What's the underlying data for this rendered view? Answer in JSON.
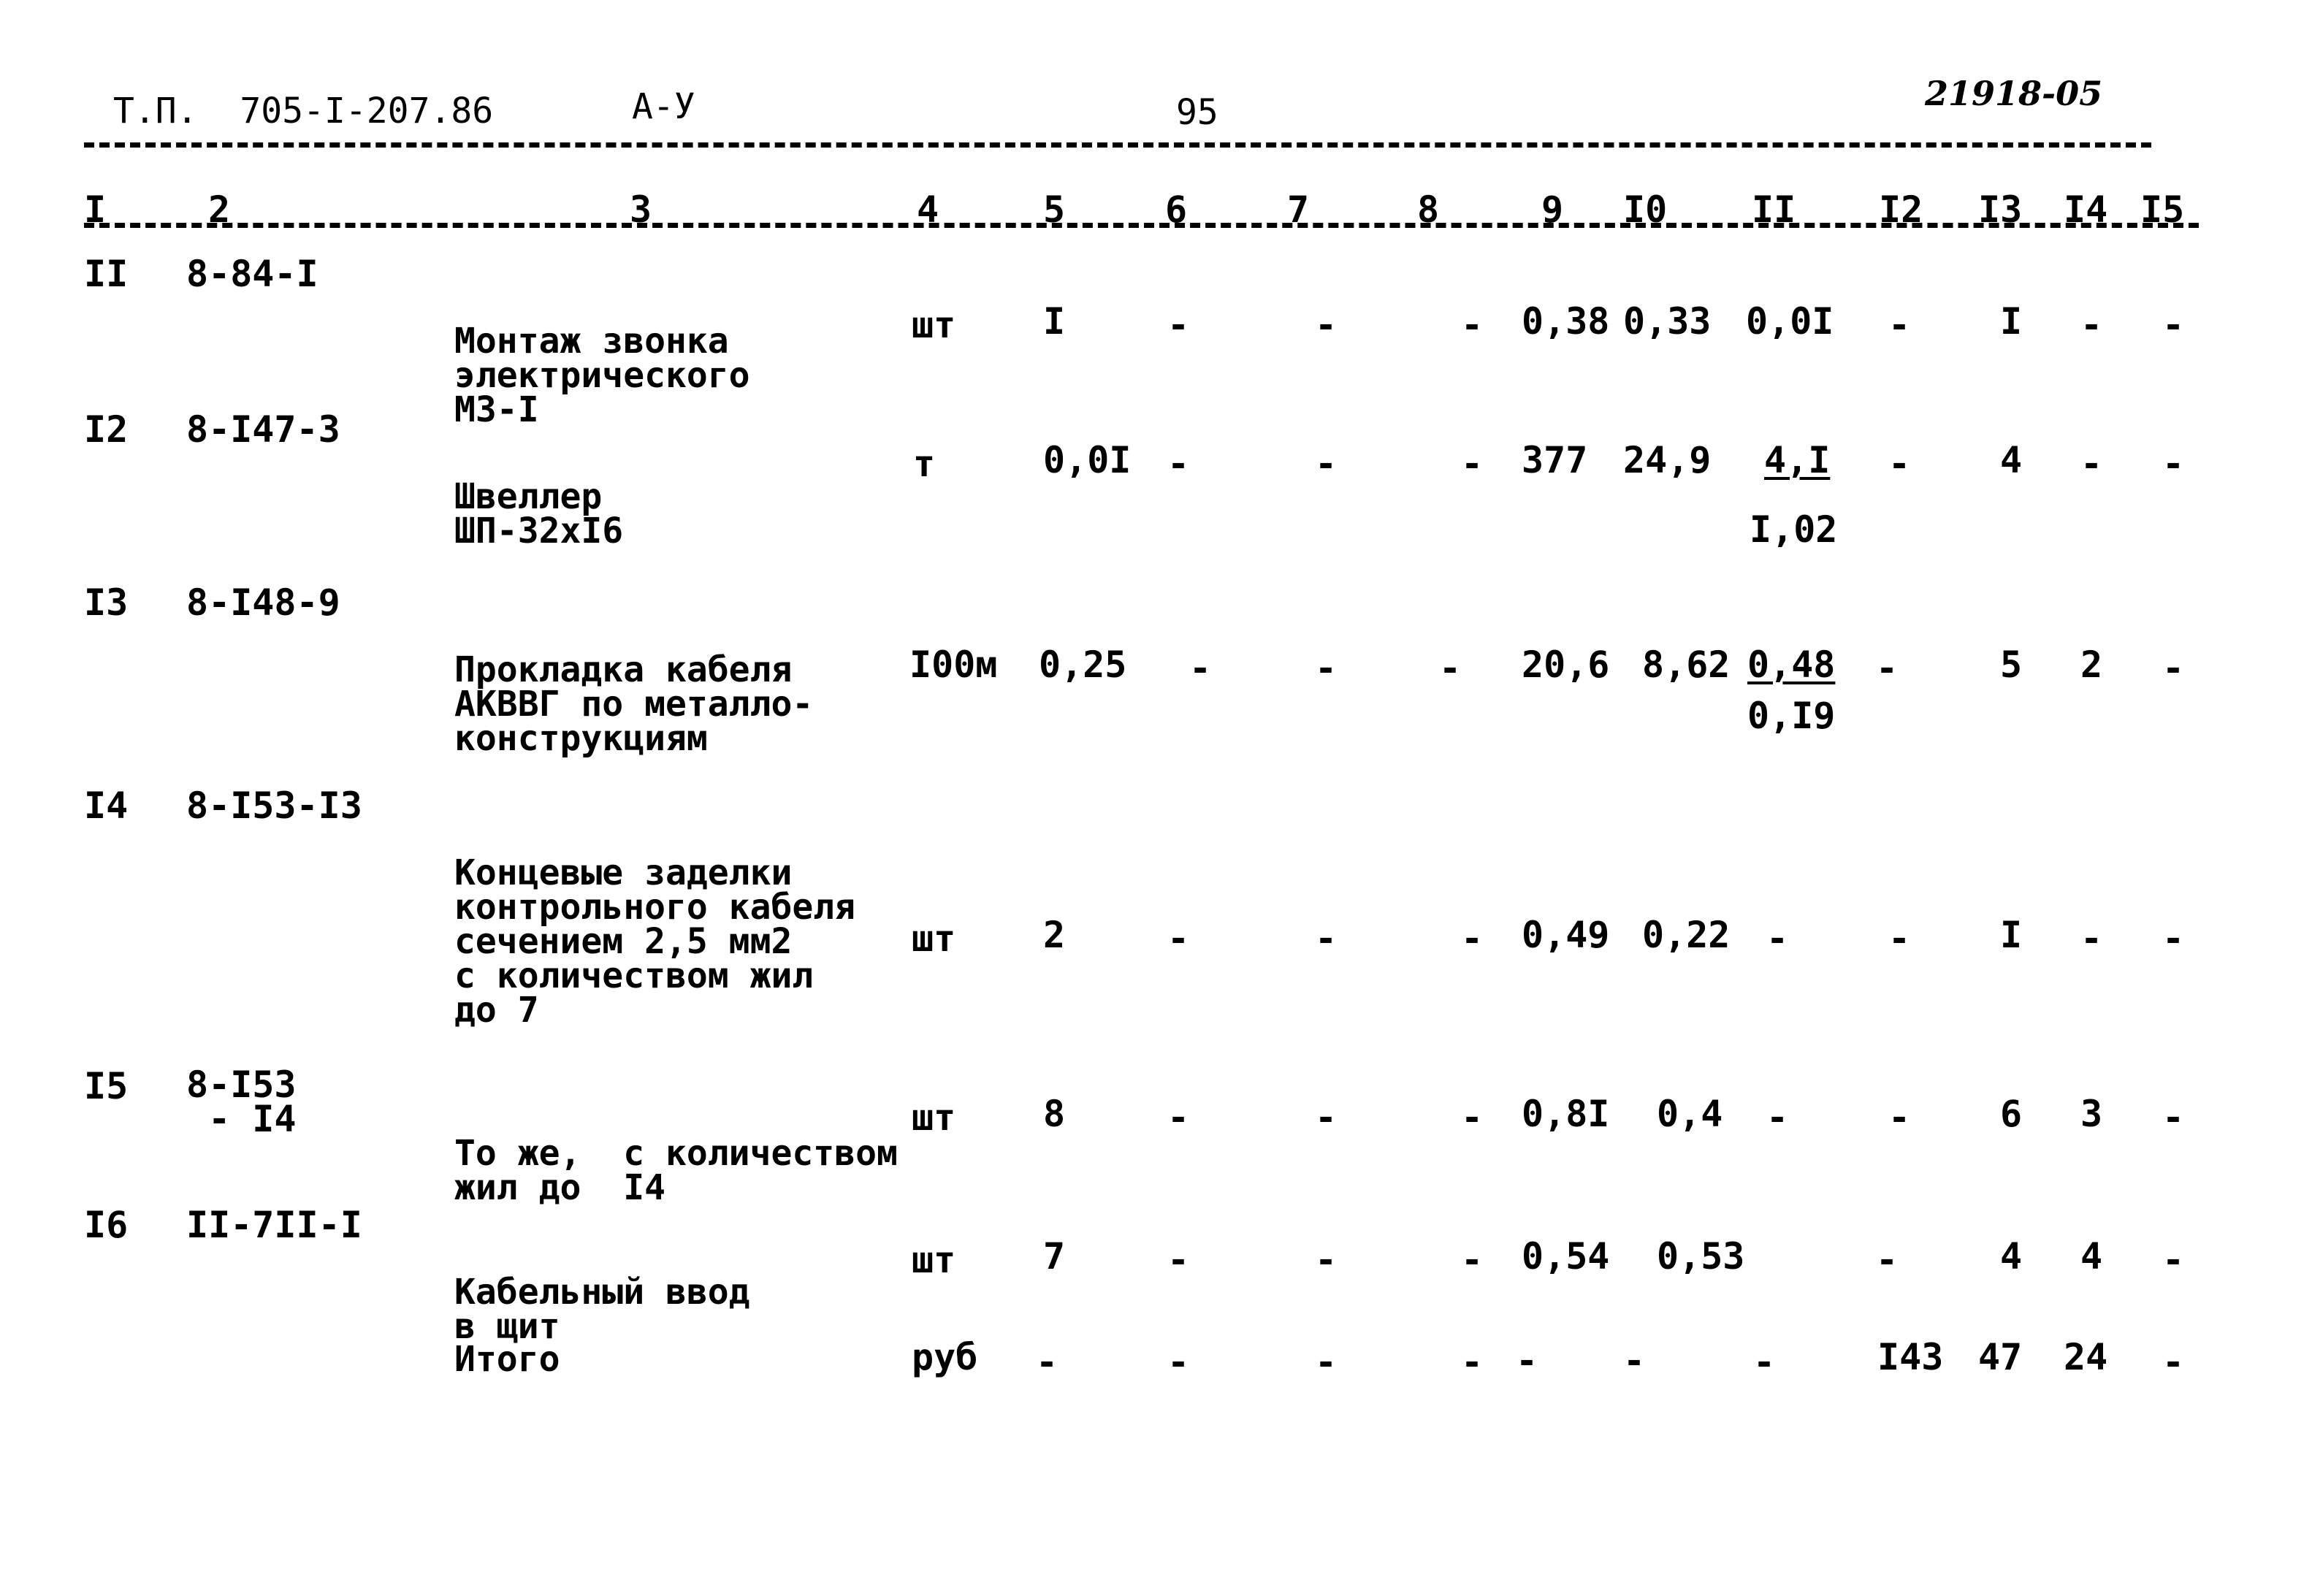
{
  "header": {
    "project_code": "Т.П.  705-I-207.86",
    "section": "А-У",
    "page_number": "95",
    "stamp": "21918-05"
  },
  "columns": [
    "I",
    "2",
    "3",
    "4",
    "5",
    "6",
    "7",
    "8",
    "9",
    "I0",
    "II",
    "I2",
    "I3",
    "I4",
    "I5"
  ],
  "rows": [
    {
      "num": "II",
      "code": "8-84-I",
      "desc": [
        "Монтаж звонка",
        "электрического",
        "МЗ-I"
      ],
      "unit": "шт",
      "qty": "I",
      "c6": "-",
      "c7": "-",
      "c8": "-",
      "c9": "0,38",
      "c10": "0,33",
      "c11": "0,0I",
      "c11b": "",
      "c12": "-",
      "c13": "I",
      "c14": "-",
      "c15": "-"
    },
    {
      "num": "I2",
      "code": "8-I47-3",
      "desc": [
        "Швеллер",
        "ШП-32хI6"
      ],
      "unit": "т",
      "qty": "0,0I",
      "c6": "-",
      "c7": "-",
      "c8": "-",
      "c9": "377",
      "c10": "24,9",
      "c11": "4,I",
      "c11b": "I,02",
      "c12": "-",
      "c13": "4",
      "c14": "-",
      "c15": "-"
    },
    {
      "num": "I3",
      "code": "8-I48-9",
      "desc": [
        "Прокладка кабеля",
        "АКВВГ по металло-",
        "конструкциям"
      ],
      "unit": "I00м",
      "qty": "0,25",
      "c6": "-",
      "c7": "-",
      "c8": "-",
      "c9": "20,6",
      "c10": "8,62",
      "c11": "0,48",
      "c11b": "0,I9",
      "c12": "-",
      "c13": "5",
      "c14": "2",
      "c15": "-"
    },
    {
      "num": "I4",
      "code": "8-I53-I3",
      "desc": [
        "Концевые заделки",
        "контрольного кабеля",
        "сечением 2,5 мм2",
        "с количеством жил",
        "до 7"
      ],
      "unit": "шт",
      "qty": "2",
      "c6": "-",
      "c7": "-",
      "c8": "-",
      "c9": "0,49",
      "c10": "0,22",
      "c11": "-",
      "c11b": "",
      "c12": "-",
      "c13": "I",
      "c14": "-",
      "c15": "-"
    },
    {
      "num": "I5",
      "code": "8-I53\n - I4",
      "desc": [
        "То же,  с количеством",
        "жил до  I4"
      ],
      "unit": "шт",
      "qty": "8",
      "c6": "-",
      "c7": "-",
      "c8": "-",
      "c9": "0,8I",
      "c10": "0,4",
      "c11": "-",
      "c11b": "",
      "c12": "-",
      "c13": "6",
      "c14": "3",
      "c15": "-"
    },
    {
      "num": "I6",
      "code": "II-7II-I",
      "desc": [
        "Кабельный ввод",
        "в щит"
      ],
      "unit": "шт",
      "qty": "7",
      "c6": "-",
      "c7": "-",
      "c8": "-",
      "c9": "0,54",
      "c10": "0,53",
      "c11": "",
      "c11b": "",
      "c12": "-",
      "c13": "4",
      "c14": "4",
      "c15": "-"
    }
  ],
  "total": {
    "label": "Итого",
    "unit": "руб",
    "c5": "-",
    "c6": "-",
    "c7": "-",
    "c8": "-",
    "c9": "-",
    "c10": "-",
    "c11": "-",
    "c12": "I43",
    "c13": "47",
    "c14": "24",
    "c15": "-"
  }
}
